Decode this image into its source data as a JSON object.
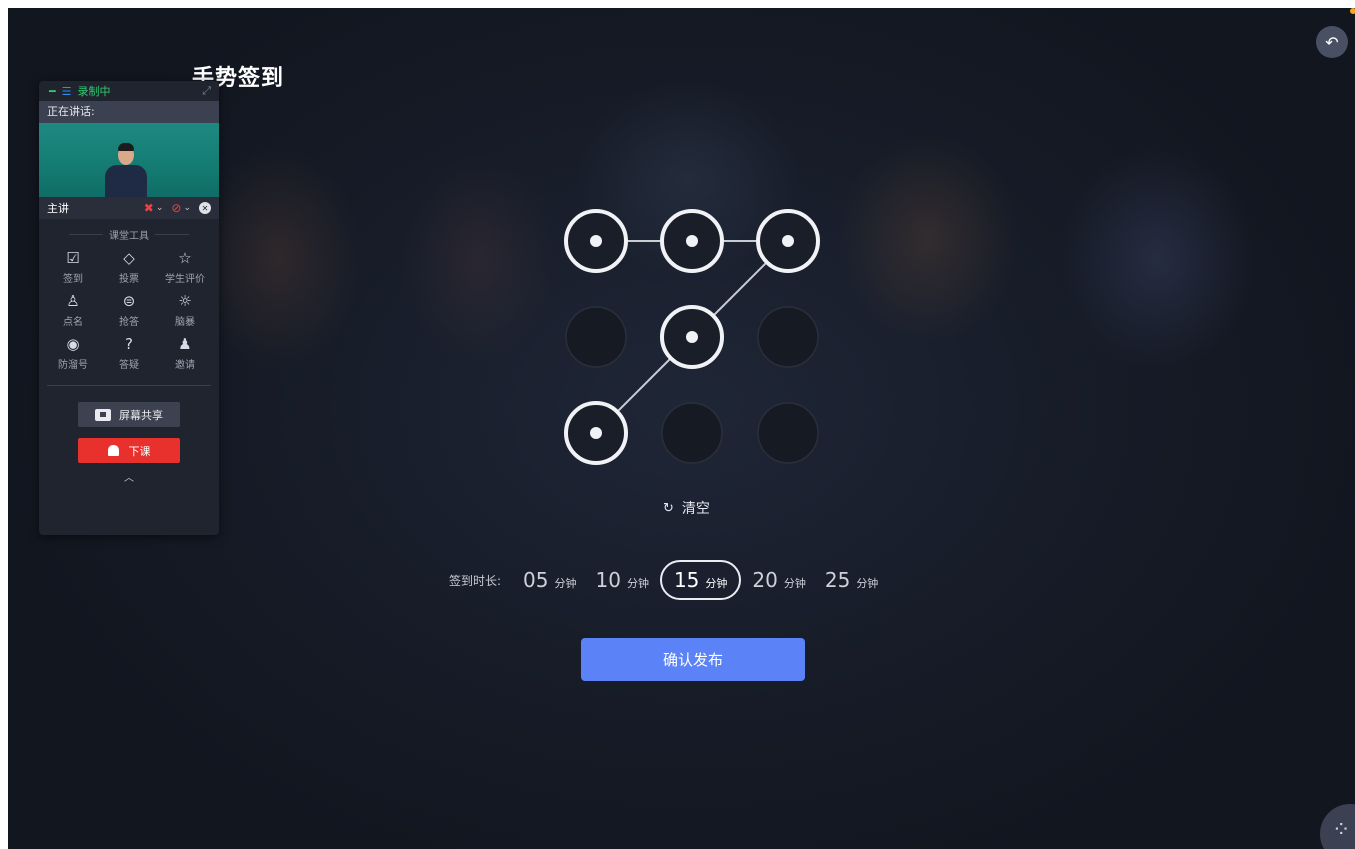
{
  "page": {
    "title": "手势签到"
  },
  "recorder": {
    "status": "录制中"
  },
  "panel": {
    "speaking_label": "正在讲话:",
    "presenter_label": "主讲",
    "tools_title": "课堂工具",
    "tools": [
      {
        "label": "签到",
        "icon": "check-in-icon"
      },
      {
        "label": "投票",
        "icon": "vote-icon"
      },
      {
        "label": "学生评价",
        "icon": "star-icon"
      },
      {
        "label": "点名",
        "icon": "roll-call-icon"
      },
      {
        "label": "抢答",
        "icon": "quick-answer-icon"
      },
      {
        "label": "脑暴",
        "icon": "brainstorm-icon"
      },
      {
        "label": "防溜号",
        "icon": "eye-icon"
      },
      {
        "label": "答疑",
        "icon": "question-icon"
      },
      {
        "label": "邀请",
        "icon": "invite-icon"
      }
    ],
    "share_label": "屏幕共享",
    "end_label": "下课"
  },
  "gesture": {
    "grid": [
      [
        true,
        true,
        true
      ],
      [
        false,
        true,
        false
      ],
      [
        true,
        false,
        false
      ]
    ],
    "path": [
      [
        0,
        0
      ],
      [
        0,
        1
      ],
      [
        0,
        2
      ],
      [
        1,
        1
      ],
      [
        2,
        0
      ]
    ]
  },
  "clear_label": "清空",
  "duration": {
    "label": "签到时长:",
    "unit": "分钟",
    "options": [
      "05",
      "10",
      "15",
      "20",
      "25"
    ],
    "selected": "15"
  },
  "confirm_label": "确认发布",
  "colors": {
    "accent": "#5b83f7",
    "danger": "#e8302d",
    "recording": "#2fcc71"
  }
}
